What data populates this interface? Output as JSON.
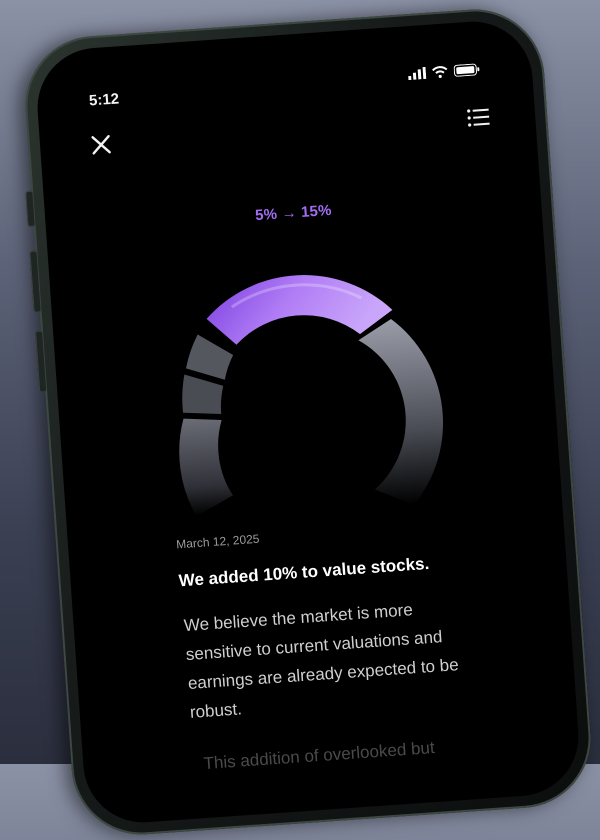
{
  "status_bar": {
    "time": "5:12"
  },
  "toolbar": {
    "close_icon": "close-icon",
    "menu_icon": "list-icon"
  },
  "allocation": {
    "change_label": "5% → 15%",
    "previous_percent": 5,
    "new_percent": 15,
    "accent_color": "#a46ef3"
  },
  "article": {
    "date": "March 12, 2025",
    "headline": "We added 10% to value stocks.",
    "body": "We believe the market is more sensitive to current valuations and earnings are already expected to be robust.",
    "next_paragraph": "This addition of overlooked but"
  }
}
